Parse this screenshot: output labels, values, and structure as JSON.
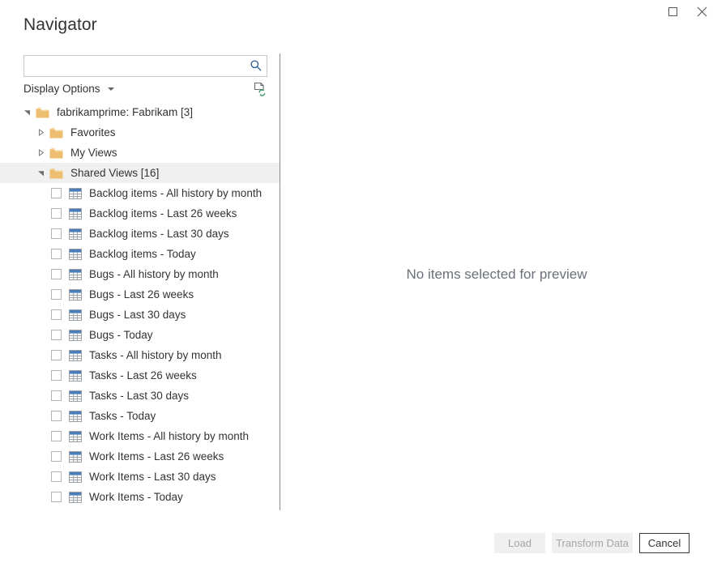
{
  "window": {
    "title": "Navigator",
    "maximize_icon": "maximize-icon",
    "close_icon": "close-icon",
    "close_glyph": "✕"
  },
  "search": {
    "value": "",
    "placeholder": "",
    "icon": "search-icon"
  },
  "toolbar": {
    "display_options_label": "Display Options",
    "caret_icon": "chevron-down-icon",
    "refresh_icon": "refresh-page-icon"
  },
  "tree": {
    "nodes": [
      {
        "label": "fabrikamprime: Fabrikam [3]",
        "level": 0,
        "type": "folder",
        "state": "expanded",
        "selected": false
      },
      {
        "label": "Favorites",
        "level": 1,
        "type": "folder",
        "state": "collapsed",
        "selected": false
      },
      {
        "label": "My Views",
        "level": 1,
        "type": "folder",
        "state": "collapsed",
        "selected": false
      },
      {
        "label": "Shared Views [16]",
        "level": 1,
        "type": "folder",
        "state": "expanded",
        "selected": true
      },
      {
        "label": "Backlog items - All history by month",
        "level": 2,
        "type": "table",
        "checked": false
      },
      {
        "label": "Backlog items - Last 26 weeks",
        "level": 2,
        "type": "table",
        "checked": false
      },
      {
        "label": "Backlog items - Last 30 days",
        "level": 2,
        "type": "table",
        "checked": false
      },
      {
        "label": "Backlog items - Today",
        "level": 2,
        "type": "table",
        "checked": false
      },
      {
        "label": "Bugs - All history by month",
        "level": 2,
        "type": "table",
        "checked": false
      },
      {
        "label": "Bugs - Last 26 weeks",
        "level": 2,
        "type": "table",
        "checked": false
      },
      {
        "label": "Bugs - Last 30 days",
        "level": 2,
        "type": "table",
        "checked": false
      },
      {
        "label": "Bugs - Today",
        "level": 2,
        "type": "table",
        "checked": false
      },
      {
        "label": "Tasks - All history by month",
        "level": 2,
        "type": "table",
        "checked": false
      },
      {
        "label": "Tasks - Last 26 weeks",
        "level": 2,
        "type": "table",
        "checked": false
      },
      {
        "label": "Tasks - Last 30 days",
        "level": 2,
        "type": "table",
        "checked": false
      },
      {
        "label": "Tasks - Today",
        "level": 2,
        "type": "table",
        "checked": false
      },
      {
        "label": "Work Items - All history by month",
        "level": 2,
        "type": "table",
        "checked": false
      },
      {
        "label": "Work Items - Last 26 weeks",
        "level": 2,
        "type": "table",
        "checked": false
      },
      {
        "label": "Work Items - Last 30 days",
        "level": 2,
        "type": "table",
        "checked": false
      },
      {
        "label": "Work Items - Today",
        "level": 2,
        "type": "table",
        "checked": false
      }
    ]
  },
  "preview": {
    "empty_message": "No items selected for preview"
  },
  "footer": {
    "load_label": "Load",
    "transform_label": "Transform Data",
    "cancel_label": "Cancel",
    "load_enabled": false,
    "transform_enabled": false
  },
  "colors": {
    "folder": "#edbe6f",
    "folder_light": "#f5d9a3",
    "table_header": "#4a7ebb",
    "table_grid": "#9aa0a6",
    "search_icon": "#2b5797",
    "refresh_green": "#3f9b6d",
    "selection": "#f0f0f0",
    "divider": "#8a8a8a",
    "text": "#333333",
    "disabled_text": "#a6a6a6"
  }
}
